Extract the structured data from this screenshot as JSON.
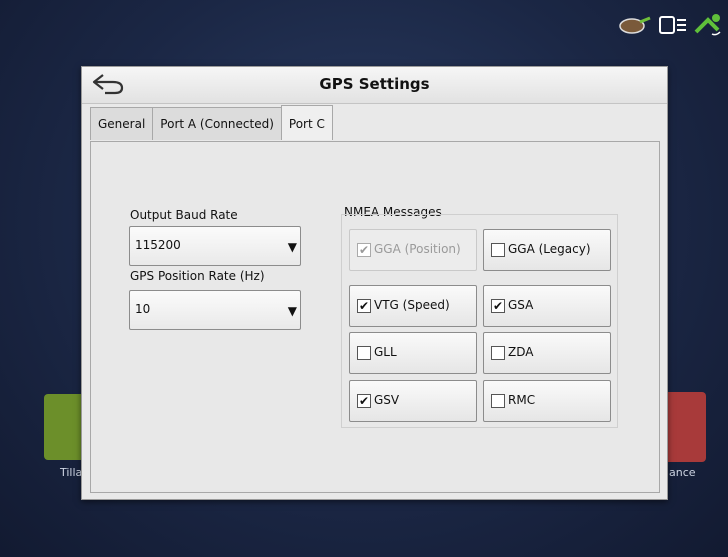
{
  "status_icons": [
    "tractor-gauge-icon",
    "display-link-icon",
    "gps-satellite-icon"
  ],
  "background": {
    "left_tile_label": "Tilla",
    "right_tile_label": "dance"
  },
  "dialog": {
    "title": "GPS Settings",
    "back_icon": "back-arrow-icon"
  },
  "tabs": [
    {
      "label": "General",
      "active": false
    },
    {
      "label": "Port A (Connected)",
      "active": false
    },
    {
      "label": "Port C",
      "active": true
    }
  ],
  "port_c": {
    "output_baud_rate": {
      "label": "Output Baud Rate",
      "value": "115200"
    },
    "gps_position_rate": {
      "label": "GPS Position Rate (Hz)",
      "value": "10"
    },
    "nmea": {
      "title": "NMEA Messages",
      "items": [
        {
          "label": "GGA (Position)",
          "checked": true,
          "disabled": true
        },
        {
          "label": "GGA (Legacy)",
          "checked": false,
          "disabled": false
        },
        {
          "label": "VTG (Speed)",
          "checked": true,
          "disabled": false
        },
        {
          "label": "GSA",
          "checked": true,
          "disabled": false
        },
        {
          "label": "GLL",
          "checked": false,
          "disabled": false
        },
        {
          "label": "ZDA",
          "checked": false,
          "disabled": false
        },
        {
          "label": "GSV",
          "checked": true,
          "disabled": false
        },
        {
          "label": "RMC",
          "checked": false,
          "disabled": false
        }
      ]
    }
  }
}
